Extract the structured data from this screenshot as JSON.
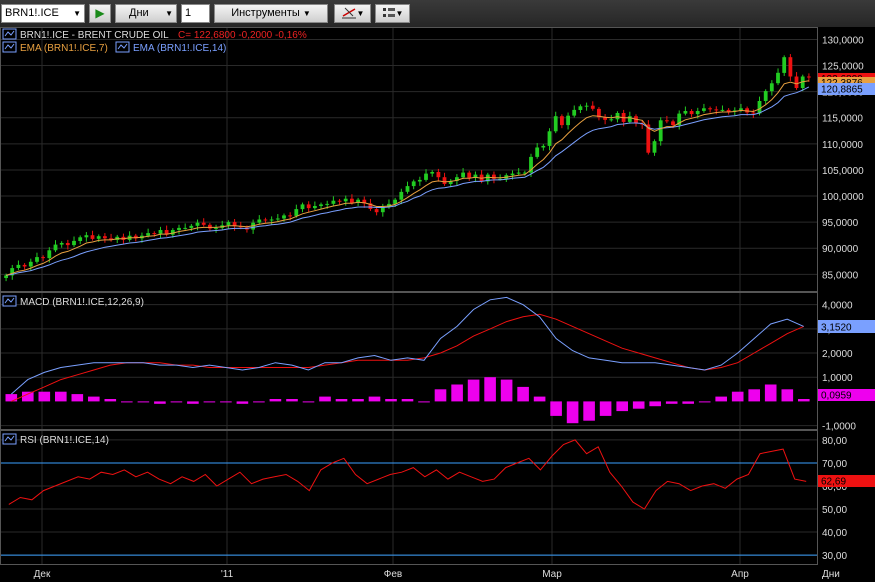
{
  "toolbar": {
    "symbol": "BRN1!.ICE",
    "go_icon": "play-arrow-icon",
    "period": "Дни",
    "period_count": "1",
    "tools": "Инструменты",
    "draw_icon": "drawing-tools-icon",
    "layout_icon": "chart-layout-icon"
  },
  "colors": {
    "background": "#000000",
    "grid": "#2a2a2a",
    "candle_up": "#22cc22",
    "candle_down": "#ee1111",
    "ema7": "#e8a040",
    "ema14": "#7aa0ff",
    "macd": "#7aa0ff",
    "signal": "#ee1111",
    "histogram": "#ee00ee",
    "rsi": "#ee1111",
    "rsi_levels": "#3aa0ff"
  },
  "price_panel": {
    "symbol_text": "BRN1!.ICE - BRENT CRUDE OIL",
    "quote_text": "C= 122,6800  -0,2000  -0,16%",
    "ema7_label": "EMA (BRN1!.ICE,7)",
    "ema14_label": "EMA (BRN1!.ICE,14)",
    "y_ticks": [
      "130,0000",
      "125,0000",
      "120,0000",
      "115,0000",
      "110,0000",
      "105,0000",
      "100,0000",
      "95,0000",
      "90,0000",
      "85,0000"
    ],
    "last_tags": [
      "122,6800",
      "122,3876",
      "120,8865"
    ]
  },
  "macd_panel": {
    "label": "MACD (BRN1!.ICE,12,26,9)",
    "y_ticks": [
      "4,0000",
      "3,0000",
      "2,0000",
      "1,0000",
      "-1,0000"
    ],
    "last_macd": "3,1520",
    "last_hist": "0,0959"
  },
  "rsi_panel": {
    "label": "RSI (BRN1!.ICE,14)",
    "y_ticks": [
      "80,00",
      "70,00",
      "60,00",
      "50,00",
      "40,00",
      "30,00"
    ],
    "last_value": "62,69"
  },
  "x_axis": {
    "ticks": [
      "Дек",
      "'11",
      "Фев",
      "Мар",
      "Апр"
    ],
    "unit": "Дни"
  },
  "chart_data": [
    {
      "type": "candlestick",
      "title": "BRN1!.ICE - BRENT CRUDE OIL",
      "x": [
        "Дек",
        "'11",
        "Фев",
        "Мар",
        "Апр"
      ],
      "ylim": [
        82,
        132
      ],
      "close": [
        84.8,
        86.2,
        86.8,
        86.5,
        87.4,
        88.3,
        88.1,
        89.6,
        90.7,
        91.0,
        90.6,
        91.4,
        92.1,
        92.5,
        91.8,
        92.3,
        91.9,
        91.6,
        92.2,
        91.6,
        92.4,
        91.9,
        92.4,
        92.9,
        92.8,
        93.5,
        92.6,
        93.5,
        93.9,
        93.9,
        94.3,
        94.9,
        94.5,
        93.8,
        93.9,
        94.4,
        95.0,
        94.2,
        94.0,
        93.6,
        94.9,
        95.5,
        95.4,
        95.5,
        95.7,
        96.3,
        96.2,
        97.5,
        98.4,
        97.7,
        98.1,
        98.4,
        98.5,
        99.1,
        99.0,
        99.5,
        98.7,
        99.3,
        98.6,
        97.5,
        96.9,
        97.9,
        98.5,
        99.3,
        100.8,
        101.9,
        102.8,
        103.1,
        104.3,
        104.6,
        103.6,
        102.3,
        102.9,
        103.6,
        104.5,
        103.5,
        104.1,
        102.8,
        104.1,
        103.3,
        103.3,
        104.0,
        104.3,
        104.5,
        104.5,
        107.5,
        109.3,
        109.6,
        112.4,
        115.3,
        113.6,
        115.4,
        116.5,
        117.2,
        117.3,
        116.7,
        115.1,
        114.6,
        114.7,
        115.9,
        114.2,
        115.3,
        113.9,
        113.7,
        108.3,
        110.5,
        114.5,
        114.3,
        113.6,
        115.8,
        116.3,
        115.7,
        116.3,
        116.8,
        116.6,
        116.5,
        116.5,
        116.2,
        116.4,
        116.8,
        116.0,
        115.8,
        118.2,
        120.1,
        121.6,
        123.6,
        126.6,
        122.9,
        120.7,
        122.9,
        122.7
      ],
      "ema7": [
        84.8,
        85.2,
        85.6,
        85.8,
        86.2,
        86.7,
        87.1,
        87.7,
        88.5,
        89.1,
        89.4,
        89.9,
        90.4,
        91.0,
        91.2,
        91.5,
        91.6,
        91.6,
        91.8,
        91.8,
        92.0,
        92.0,
        92.1,
        92.3,
        92.4,
        92.7,
        92.7,
        92.9,
        93.2,
        93.4,
        93.6,
        93.9,
        94.0,
        94.0,
        94.0,
        94.1,
        94.3,
        94.3,
        94.2,
        94.1,
        94.3,
        94.6,
        94.8,
        94.9,
        95.1,
        95.4,
        95.6,
        96.1,
        96.6,
        96.9,
        97.2,
        97.5,
        97.8,
        98.1,
        98.3,
        98.6,
        98.6,
        98.8,
        98.7,
        98.4,
        98.0,
        98.0,
        98.1,
        98.4,
        99.0,
        99.7,
        100.5,
        101.2,
        102.0,
        102.7,
        102.9,
        102.7,
        102.8,
        103.0,
        103.4,
        103.4,
        103.6,
        103.4,
        103.6,
        103.5,
        103.5,
        103.6,
        103.8,
        104.0,
        104.1,
        105.0,
        106.1,
        107.0,
        108.3,
        110.0,
        110.8,
        112.0,
        113.1,
        114.1,
        115.0,
        115.4,
        115.3,
        115.1,
        115.0,
        115.2,
        115.0,
        115.0,
        114.7,
        114.5,
        113.0,
        112.4,
        112.9,
        113.3,
        113.3,
        114.0,
        114.6,
        114.9,
        115.2,
        115.6,
        115.8,
        116.0,
        116.1,
        116.1,
        116.2,
        116.4,
        116.3,
        116.2,
        116.7,
        117.5,
        118.5,
        119.8,
        121.5,
        121.8,
        121.5,
        121.9,
        122.1
      ],
      "ema14": [
        84.8,
        85.0,
        85.3,
        85.5,
        85.7,
        86.1,
        86.4,
        86.8,
        87.3,
        87.7,
        88.0,
        88.4,
        88.9,
        89.3,
        89.6,
        89.9,
        90.2,
        90.4,
        90.6,
        90.8,
        91.0,
        91.1,
        91.3,
        91.5,
        91.7,
        91.9,
        92.0,
        92.2,
        92.4,
        92.6,
        92.8,
        93.1,
        93.2,
        93.3,
        93.4,
        93.5,
        93.7,
        93.8,
        93.8,
        93.8,
        94.0,
        94.2,
        94.3,
        94.5,
        94.6,
        94.8,
        95.0,
        95.4,
        95.8,
        96.0,
        96.3,
        96.6,
        96.8,
        97.1,
        97.3,
        97.6,
        97.7,
        97.9,
        97.9,
        97.9,
        97.8,
        97.8,
        97.9,
        98.1,
        98.6,
        99.0,
        99.6,
        100.0,
        100.7,
        101.2,
        101.5,
        101.6,
        101.8,
        102.0,
        102.4,
        102.6,
        102.8,
        102.8,
        103.0,
        103.1,
        103.1,
        103.2,
        103.4,
        103.5,
        103.6,
        104.2,
        104.9,
        105.5,
        106.5,
        107.7,
        108.5,
        109.4,
        110.3,
        111.2,
        112.0,
        112.6,
        112.9,
        113.1,
        113.3,
        113.7,
        113.8,
        114.0,
        114.0,
        113.9,
        113.1,
        112.8,
        113.0,
        113.1,
        113.2,
        113.4,
        113.7,
        114.0,
        114.3,
        114.6,
        114.8,
        115.0,
        115.2,
        115.3,
        115.4,
        115.6,
        115.6,
        115.6,
        115.9,
        116.5,
        117.1,
        117.9,
        119.1,
        119.5,
        119.8,
        120.3,
        120.9
      ]
    },
    {
      "type": "line",
      "title": "MACD (BRN1!.ICE,12,26,9)",
      "ylim": [
        -1.1,
        4.4
      ],
      "macd": [
        0.3,
        0.9,
        1.2,
        1.4,
        1.5,
        1.6,
        1.6,
        1.6,
        1.6,
        1.5,
        1.5,
        1.4,
        1.5,
        1.4,
        1.3,
        1.4,
        1.6,
        1.5,
        1.3,
        1.6,
        1.6,
        1.8,
        1.9,
        1.7,
        1.8,
        1.7,
        2.6,
        3.1,
        3.8,
        4.2,
        4.3,
        4.0,
        3.5,
        2.6,
        2.1,
        1.8,
        1.7,
        1.6,
        1.6,
        1.6,
        1.5,
        1.4,
        1.3,
        1.5,
        2.0,
        2.6,
        3.2,
        3.4,
        3.1
      ],
      "signal": [
        0.0,
        0.3,
        0.6,
        0.9,
        1.1,
        1.3,
        1.5,
        1.6,
        1.6,
        1.6,
        1.5,
        1.5,
        1.4,
        1.4,
        1.4,
        1.4,
        1.4,
        1.4,
        1.4,
        1.5,
        1.6,
        1.7,
        1.7,
        1.7,
        1.7,
        1.8,
        2.0,
        2.3,
        2.7,
        3.0,
        3.3,
        3.5,
        3.6,
        3.4,
        3.1,
        2.8,
        2.5,
        2.2,
        2.0,
        1.8,
        1.6,
        1.4,
        1.3,
        1.4,
        1.6,
        2.0,
        2.4,
        2.8,
        3.1
      ],
      "histogram": [
        0.3,
        0.4,
        0.4,
        0.4,
        0.3,
        0.2,
        0.1,
        0.0,
        0.0,
        -0.1,
        0.0,
        -0.1,
        0.0,
        0.0,
        -0.1,
        0.0,
        0.1,
        0.1,
        0.0,
        0.2,
        0.1,
        0.1,
        0.2,
        0.1,
        0.1,
        0.0,
        0.5,
        0.7,
        0.9,
        1.0,
        0.9,
        0.6,
        0.2,
        -0.6,
        -0.9,
        -0.8,
        -0.6,
        -0.4,
        -0.3,
        -0.2,
        -0.1,
        -0.1,
        0.0,
        0.2,
        0.4,
        0.5,
        0.7,
        0.5,
        0.1
      ]
    },
    {
      "type": "line",
      "title": "RSI (BRN1!.ICE,14)",
      "ylim": [
        27,
        83
      ],
      "levels": [
        70,
        30
      ],
      "rsi": [
        52,
        55,
        54,
        58,
        60,
        62,
        64,
        63,
        66,
        65,
        67,
        64,
        66,
        63,
        61,
        64,
        62,
        65,
        60,
        63,
        66,
        61,
        63,
        64,
        65,
        62,
        58,
        67,
        70,
        72,
        65,
        61,
        63,
        65,
        66,
        68,
        64,
        67,
        63,
        66,
        64,
        62,
        63,
        68,
        70,
        72,
        67,
        73,
        78,
        80,
        74,
        77,
        66,
        60,
        53,
        50,
        58,
        62,
        61,
        58,
        60,
        61,
        59,
        63,
        65,
        74,
        75,
        76,
        63,
        62
      ]
    }
  ]
}
